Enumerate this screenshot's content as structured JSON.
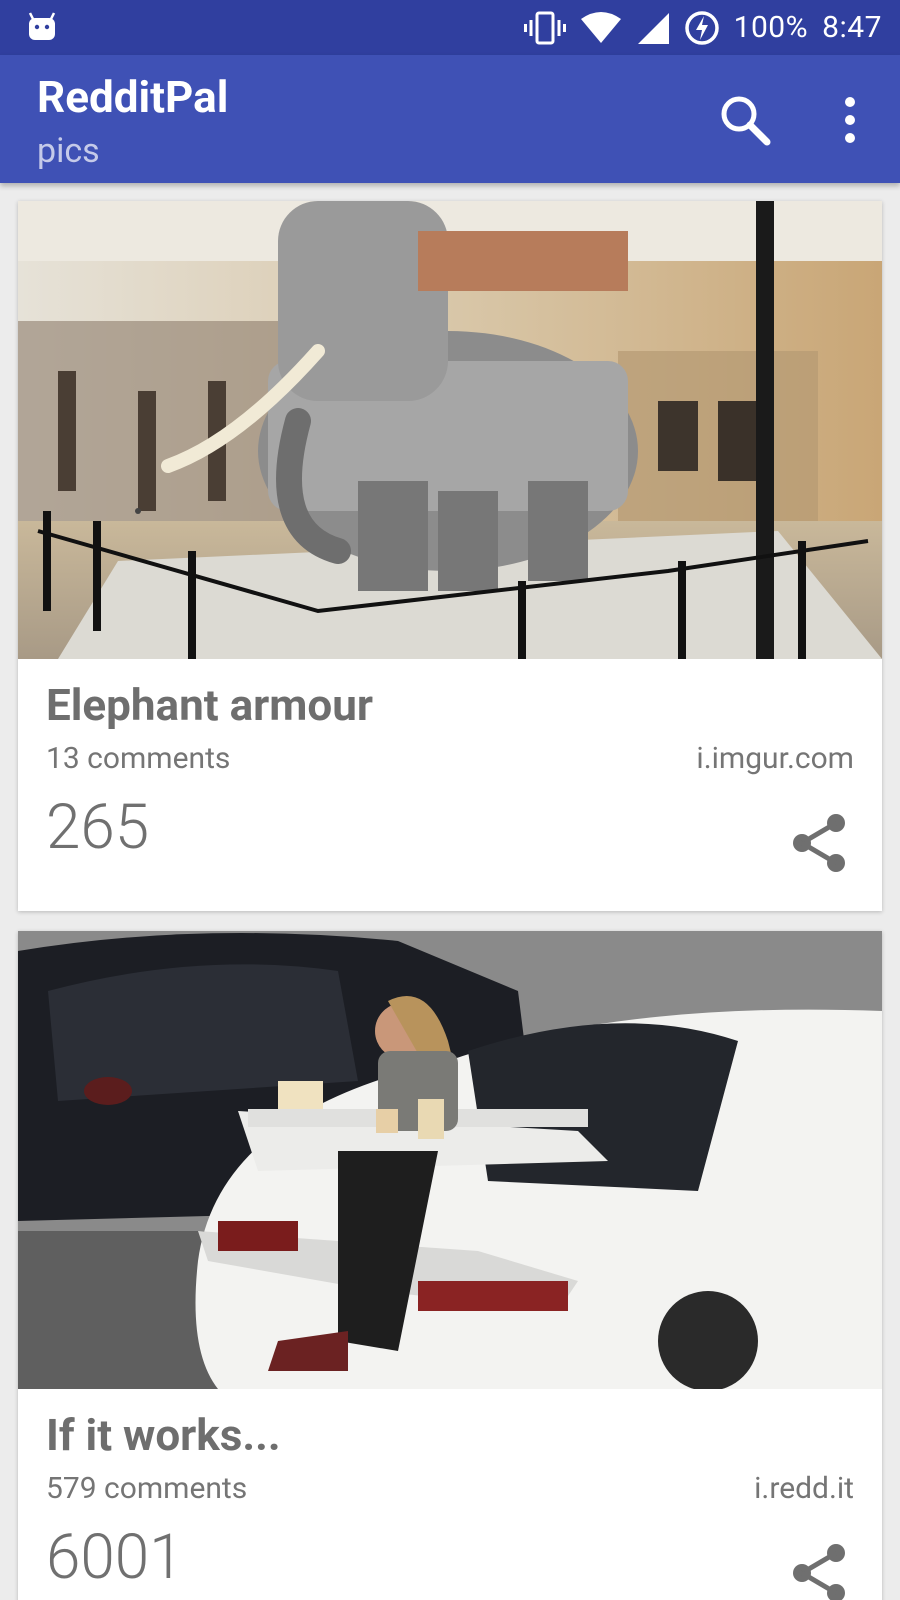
{
  "status_bar": {
    "battery_text": "100%",
    "time": "8:47",
    "icons": [
      "android-notification-icon",
      "vibrate-icon",
      "wifi-icon",
      "signal-icon",
      "battery-charging-icon"
    ]
  },
  "app_bar": {
    "title": "RedditPal",
    "subtitle": "pics",
    "actions": [
      "search-icon",
      "more-vert-icon"
    ]
  },
  "posts": [
    {
      "title": "Elephant armour",
      "comments": "13 comments",
      "domain": "i.imgur.com",
      "score": "265",
      "image": "armored-elephant-museum-photo"
    },
    {
      "title": "If it works...",
      "comments": "579 comments",
      "domain": "i.redd.it",
      "score": "6001",
      "image": "woman-eating-on-car-spoiler-photo"
    }
  ],
  "colors": {
    "status_bar": "#303f9f",
    "app_bar": "#3f51b5",
    "subtitle": "#c5cae9",
    "background": "#ececec"
  }
}
